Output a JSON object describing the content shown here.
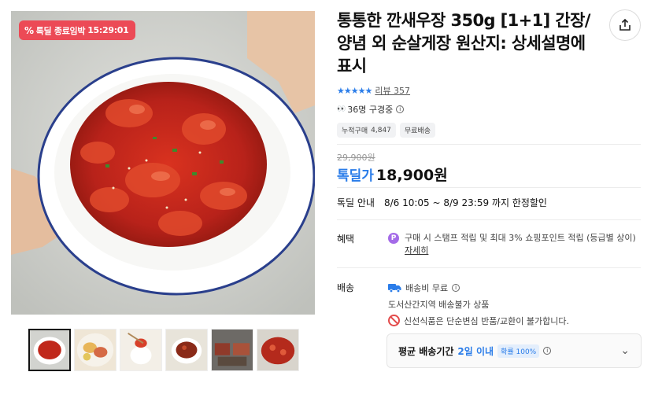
{
  "gallery": {
    "timer_badge": {
      "icon": "percent-icon",
      "label": "톡딜 종료임박",
      "time": "15:29:01",
      "color": "#ec4a56"
    },
    "thumbnails": [
      {
        "name": "seasoned-shrimp",
        "active": true
      },
      {
        "name": "soy-shrimp-plate"
      },
      {
        "name": "chopsticks-bite"
      },
      {
        "name": "crab-dish"
      },
      {
        "name": "market-display"
      },
      {
        "name": "seasoned-crab-closeup"
      }
    ]
  },
  "product": {
    "title": "통통한 깐새우장 350g [1+1] 간장/양념 외 순살게장 원산지: 상세설명에 표시",
    "rating_stars": "★★★★★",
    "review_link": "리뷰 357",
    "viewers": "36명 구경중",
    "tags": [
      {
        "label": "누적구매",
        "value": "4,847"
      },
      {
        "label": "무료배송",
        "value": ""
      }
    ],
    "original_price": "29,900원",
    "sale_label": "톡딜가",
    "sale_price": "18,900원",
    "deal": {
      "label": "톡딜 안내",
      "text": "8/6 10:05 ~ 8/9 23:59 까지 한정할인"
    },
    "benefit": {
      "label": "혜택",
      "icon": "P",
      "text": "구매 시 스탬프 적립 및 최대 3% 쇼핑포인트 적립 (등급별 상이)",
      "link": "자세히"
    },
    "shipping": {
      "label": "배송",
      "fee": "배송비 무료",
      "region_note": "도서산간지역 배송불가 상품",
      "warning": "신선식품은 단순변심 반품/교환이 불가합니다."
    },
    "delivery": {
      "label": "평균 배송기간",
      "value": "2일 이내",
      "badge": "확률 100%"
    }
  },
  "colors": {
    "accent_blue": "#2b7de9",
    "badge_red": "#ec4a56",
    "point_purple": "#a46be8"
  }
}
